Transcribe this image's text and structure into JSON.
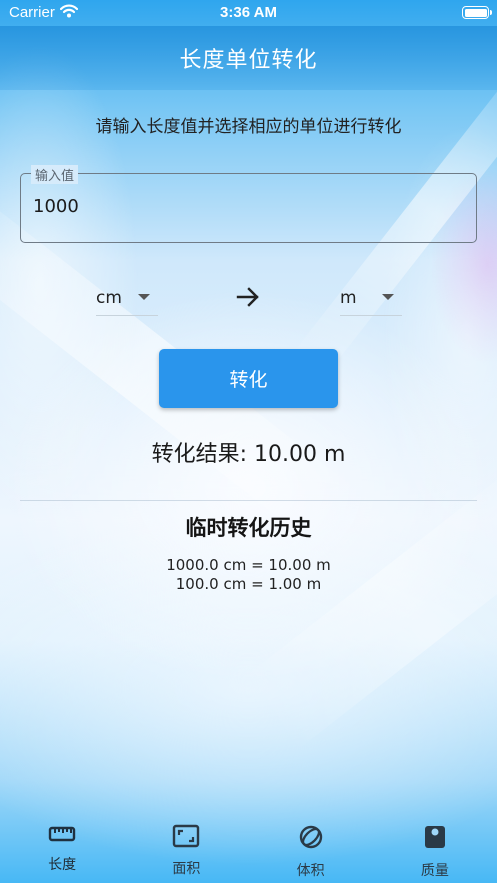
{
  "status_bar": {
    "carrier": "Carrier",
    "time": "3:36 AM"
  },
  "app_bar": {
    "title": "长度单位转化"
  },
  "instruction": "请输入长度值并选择相应的单位进行转化",
  "input": {
    "label": "输入值",
    "value": "1000"
  },
  "units": {
    "from": "cm",
    "to": "m"
  },
  "convert_button": "转化",
  "result": "转化结果: 10.00 m",
  "history": {
    "title": "临时转化历史",
    "items": [
      "1000.0 cm = 10.00 m",
      "100.0 cm = 1.00 m"
    ]
  },
  "bottom_nav": [
    {
      "label": "长度",
      "icon": "ruler-icon",
      "active": true
    },
    {
      "label": "面积",
      "icon": "area-icon",
      "active": false
    },
    {
      "label": "体积",
      "icon": "volume-icon",
      "active": false
    },
    {
      "label": "质量",
      "icon": "scale-icon",
      "active": false
    }
  ],
  "colors": {
    "primary": "#2a95ec",
    "text": "#222222"
  }
}
